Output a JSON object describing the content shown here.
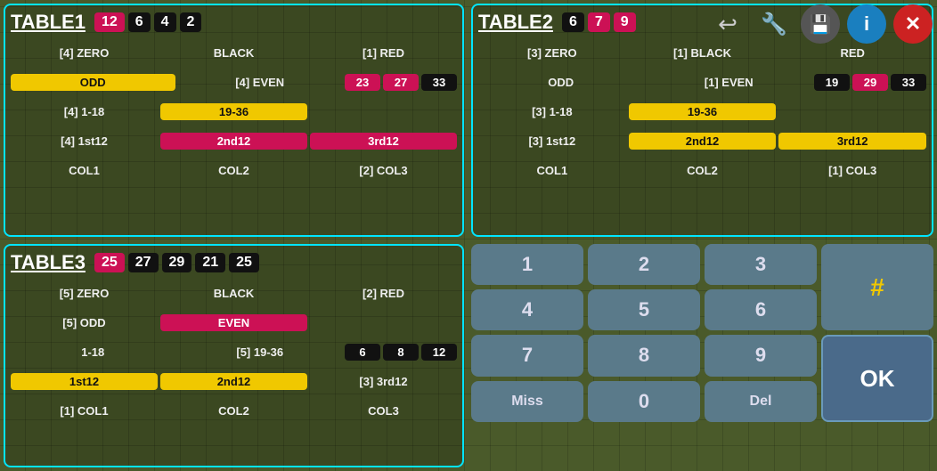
{
  "toolbar": {
    "back_label": "↩",
    "wrench_label": "🔧",
    "save_label": "💾",
    "info_label": "i",
    "close_label": "✕"
  },
  "table1": {
    "title": "TABLE1",
    "badges": [
      {
        "value": "12",
        "type": "red"
      },
      {
        "value": "6",
        "type": "black"
      },
      {
        "value": "4",
        "type": "black"
      },
      {
        "value": "2",
        "type": "black"
      }
    ],
    "rows": [
      {
        "cells": [
          {
            "text": "[4] ZERO",
            "style": "transparent",
            "flex": 2
          },
          {
            "text": "BLACK",
            "style": "transparent",
            "flex": 2
          },
          {
            "text": "[1] RED",
            "style": "transparent",
            "flex": 2
          }
        ]
      },
      {
        "cells": [
          {
            "text": "ODD",
            "style": "yellow",
            "flex": 2
          },
          {
            "text": "[4] EVEN",
            "style": "transparent",
            "flex": 2
          },
          {
            "text": "23",
            "style": "red",
            "w": 35
          },
          {
            "text": "27",
            "style": "red",
            "w": 35
          },
          {
            "text": "33",
            "style": "black",
            "w": 35
          }
        ]
      },
      {
        "cells": [
          {
            "text": "[4] 1-18",
            "style": "transparent",
            "flex": 2
          },
          {
            "text": "19-36",
            "style": "yellow",
            "flex": 2
          },
          {
            "text": "",
            "style": "transparent",
            "flex": 2
          }
        ]
      },
      {
        "cells": [
          {
            "text": "[4] 1st12",
            "style": "transparent",
            "flex": 2
          },
          {
            "text": "2nd12",
            "style": "red",
            "flex": 2
          },
          {
            "text": "3rd12",
            "style": "red",
            "flex": 2
          }
        ]
      },
      {
        "cells": [
          {
            "text": "COL1",
            "style": "transparent",
            "flex": 2
          },
          {
            "text": "COL2",
            "style": "transparent",
            "flex": 2
          },
          {
            "text": "[2] COL3",
            "style": "transparent",
            "flex": 2
          }
        ]
      }
    ]
  },
  "table2": {
    "title": "TABLE2",
    "badges": [
      {
        "value": "6",
        "type": "black"
      },
      {
        "value": "7",
        "type": "red"
      },
      {
        "value": "9",
        "type": "red"
      }
    ],
    "rows": [
      {
        "cells": [
          {
            "text": "[3] ZERO",
            "style": "transparent",
            "flex": 2
          },
          {
            "text": "[1] BLACK",
            "style": "transparent",
            "flex": 2
          },
          {
            "text": "RED",
            "style": "transparent",
            "flex": 2
          }
        ]
      },
      {
        "cells": [
          {
            "text": "ODD",
            "style": "transparent",
            "flex": 2
          },
          {
            "text": "[1] EVEN",
            "style": "transparent",
            "flex": 2
          },
          {
            "text": "19",
            "style": "black",
            "w": 35
          },
          {
            "text": "29",
            "style": "red",
            "w": 35
          },
          {
            "text": "33",
            "style": "black",
            "w": 35
          }
        ]
      },
      {
        "cells": [
          {
            "text": "[3] 1-18",
            "style": "transparent",
            "flex": 2
          },
          {
            "text": "19-36",
            "style": "yellow",
            "flex": 2
          },
          {
            "text": "",
            "style": "transparent",
            "flex": 2
          }
        ]
      },
      {
        "cells": [
          {
            "text": "[3] 1st12",
            "style": "transparent",
            "flex": 2
          },
          {
            "text": "2nd12",
            "style": "yellow",
            "flex": 2
          },
          {
            "text": "3rd12",
            "style": "yellow",
            "flex": 2
          }
        ]
      },
      {
        "cells": [
          {
            "text": "COL1",
            "style": "transparent",
            "flex": 2
          },
          {
            "text": "COL2",
            "style": "transparent",
            "flex": 2
          },
          {
            "text": "[1] COL3",
            "style": "transparent",
            "flex": 2
          }
        ]
      }
    ]
  },
  "table3": {
    "title": "TABLE3",
    "badges": [
      {
        "value": "25",
        "type": "red"
      },
      {
        "value": "27",
        "type": "black"
      },
      {
        "value": "29",
        "type": "black"
      },
      {
        "value": "21",
        "type": "black"
      },
      {
        "value": "25",
        "type": "black"
      }
    ],
    "rows": [
      {
        "cells": [
          {
            "text": "[5] ZERO",
            "style": "transparent",
            "flex": 2
          },
          {
            "text": "BLACK",
            "style": "transparent",
            "flex": 2
          },
          {
            "text": "[2] RED",
            "style": "transparent",
            "flex": 2
          }
        ]
      },
      {
        "cells": [
          {
            "text": "[5] ODD",
            "style": "transparent",
            "flex": 2
          },
          {
            "text": "EVEN",
            "style": "red",
            "flex": 2
          },
          {
            "text": "",
            "style": "transparent",
            "flex": 2
          }
        ]
      },
      {
        "cells": [
          {
            "text": "1-18",
            "style": "transparent",
            "flex": 2
          },
          {
            "text": "[5] 19-36",
            "style": "transparent",
            "flex": 2
          },
          {
            "text": "6",
            "style": "black",
            "w": 35
          },
          {
            "text": "8",
            "style": "black",
            "w": 35
          },
          {
            "text": "12",
            "style": "black",
            "w": 35
          }
        ]
      },
      {
        "cells": [
          {
            "text": "1st12",
            "style": "yellow",
            "flex": 2
          },
          {
            "text": "2nd12",
            "style": "yellow",
            "flex": 2
          },
          {
            "text": "[3] 3rd12",
            "style": "transparent",
            "flex": 2
          }
        ]
      },
      {
        "cells": [
          {
            "text": "[1] COL1",
            "style": "transparent",
            "flex": 2
          },
          {
            "text": "COL2",
            "style": "transparent",
            "flex": 2
          },
          {
            "text": "COL3",
            "style": "transparent",
            "flex": 2
          }
        ]
      }
    ]
  },
  "numpad": {
    "keys": [
      "1",
      "2",
      "3",
      "4",
      "5",
      "6",
      "7",
      "8",
      "9",
      "Miss",
      "0",
      "Del"
    ],
    "hash": "#",
    "ok": "OK"
  }
}
